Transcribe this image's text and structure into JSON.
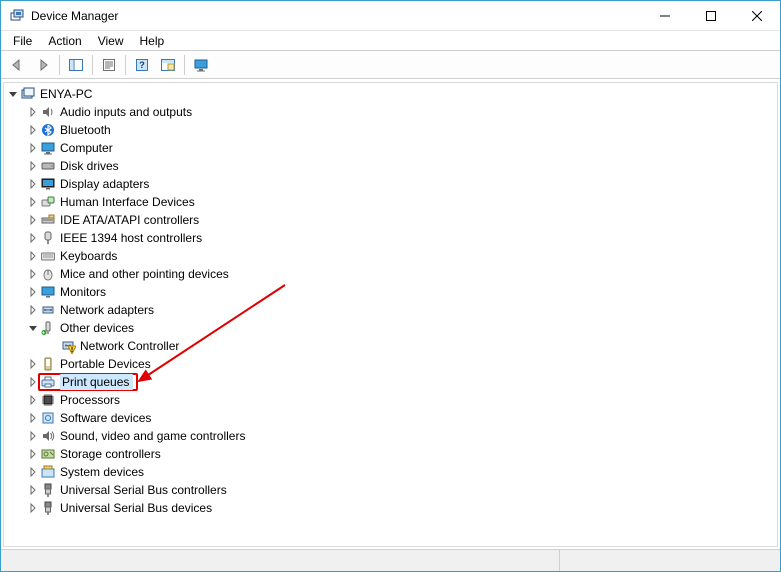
{
  "window": {
    "title": "Device Manager"
  },
  "menus": {
    "file": "File",
    "action": "Action",
    "view": "View",
    "help": "Help"
  },
  "root": {
    "name": "ENYA-PC"
  },
  "categories": [
    {
      "id": "audio",
      "label": "Audio inputs and outputs",
      "expanded": false
    },
    {
      "id": "bluetooth",
      "label": "Bluetooth",
      "expanded": false
    },
    {
      "id": "computer",
      "label": "Computer",
      "expanded": false
    },
    {
      "id": "disk",
      "label": "Disk drives",
      "expanded": false
    },
    {
      "id": "display",
      "label": "Display adapters",
      "expanded": false
    },
    {
      "id": "hid",
      "label": "Human Interface Devices",
      "expanded": false
    },
    {
      "id": "ide",
      "label": "IDE ATA/ATAPI controllers",
      "expanded": false
    },
    {
      "id": "ieee1394",
      "label": "IEEE 1394 host controllers",
      "expanded": false
    },
    {
      "id": "keyboards",
      "label": "Keyboards",
      "expanded": false
    },
    {
      "id": "mice",
      "label": "Mice and other pointing devices",
      "expanded": false
    },
    {
      "id": "monitors",
      "label": "Monitors",
      "expanded": false
    },
    {
      "id": "network",
      "label": "Network adapters",
      "expanded": false
    },
    {
      "id": "other",
      "label": "Other devices",
      "expanded": true,
      "children": [
        {
          "id": "netctrl",
          "label": "Network Controller",
          "warn": true
        }
      ]
    },
    {
      "id": "portable",
      "label": "Portable Devices",
      "expanded": false
    },
    {
      "id": "printq",
      "label": "Print queues",
      "expanded": false,
      "selected": true,
      "highlighted": true
    },
    {
      "id": "processors",
      "label": "Processors",
      "expanded": false
    },
    {
      "id": "software",
      "label": "Software devices",
      "expanded": false
    },
    {
      "id": "sound",
      "label": "Sound, video and game controllers",
      "expanded": false
    },
    {
      "id": "storage",
      "label": "Storage controllers",
      "expanded": false
    },
    {
      "id": "system",
      "label": "System devices",
      "expanded": false
    },
    {
      "id": "usbctrl",
      "label": "Universal Serial Bus controllers",
      "expanded": false
    },
    {
      "id": "usbdev",
      "label": "Universal Serial Bus devices",
      "expanded": false
    }
  ]
}
